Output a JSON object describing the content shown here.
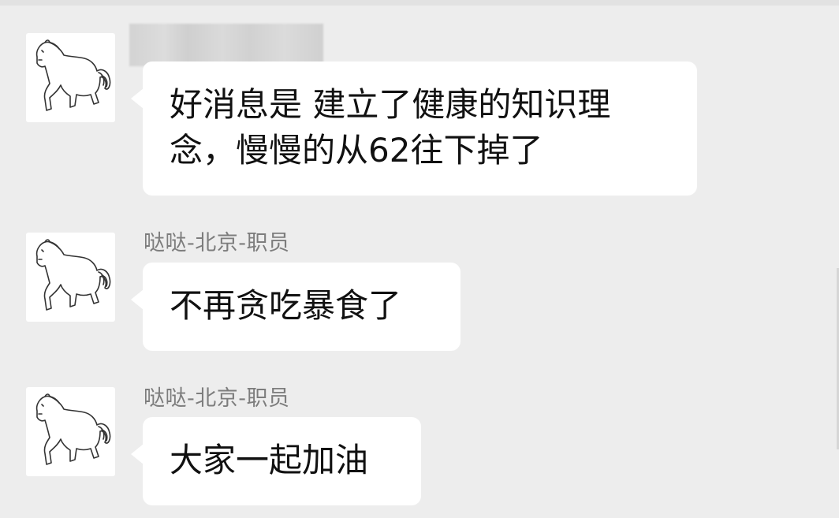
{
  "messages": [
    {
      "sender": "",
      "sender_redacted": true,
      "avatar_icon": "horse-icon",
      "text": "好消息是 建立了健康的知识理\n念，慢慢的从62往下掉了"
    },
    {
      "sender": "哒哒-北京-职员",
      "sender_redacted": false,
      "avatar_icon": "horse-icon",
      "text": "不再贪吃暴食了"
    },
    {
      "sender": "哒哒-北京-职员",
      "sender_redacted": false,
      "avatar_icon": "horse-icon",
      "text": "大家一起加油"
    }
  ],
  "colors": {
    "background": "#ededed",
    "bubble": "#ffffff",
    "sender_text": "#7d7d7d",
    "message_text": "#111111"
  }
}
